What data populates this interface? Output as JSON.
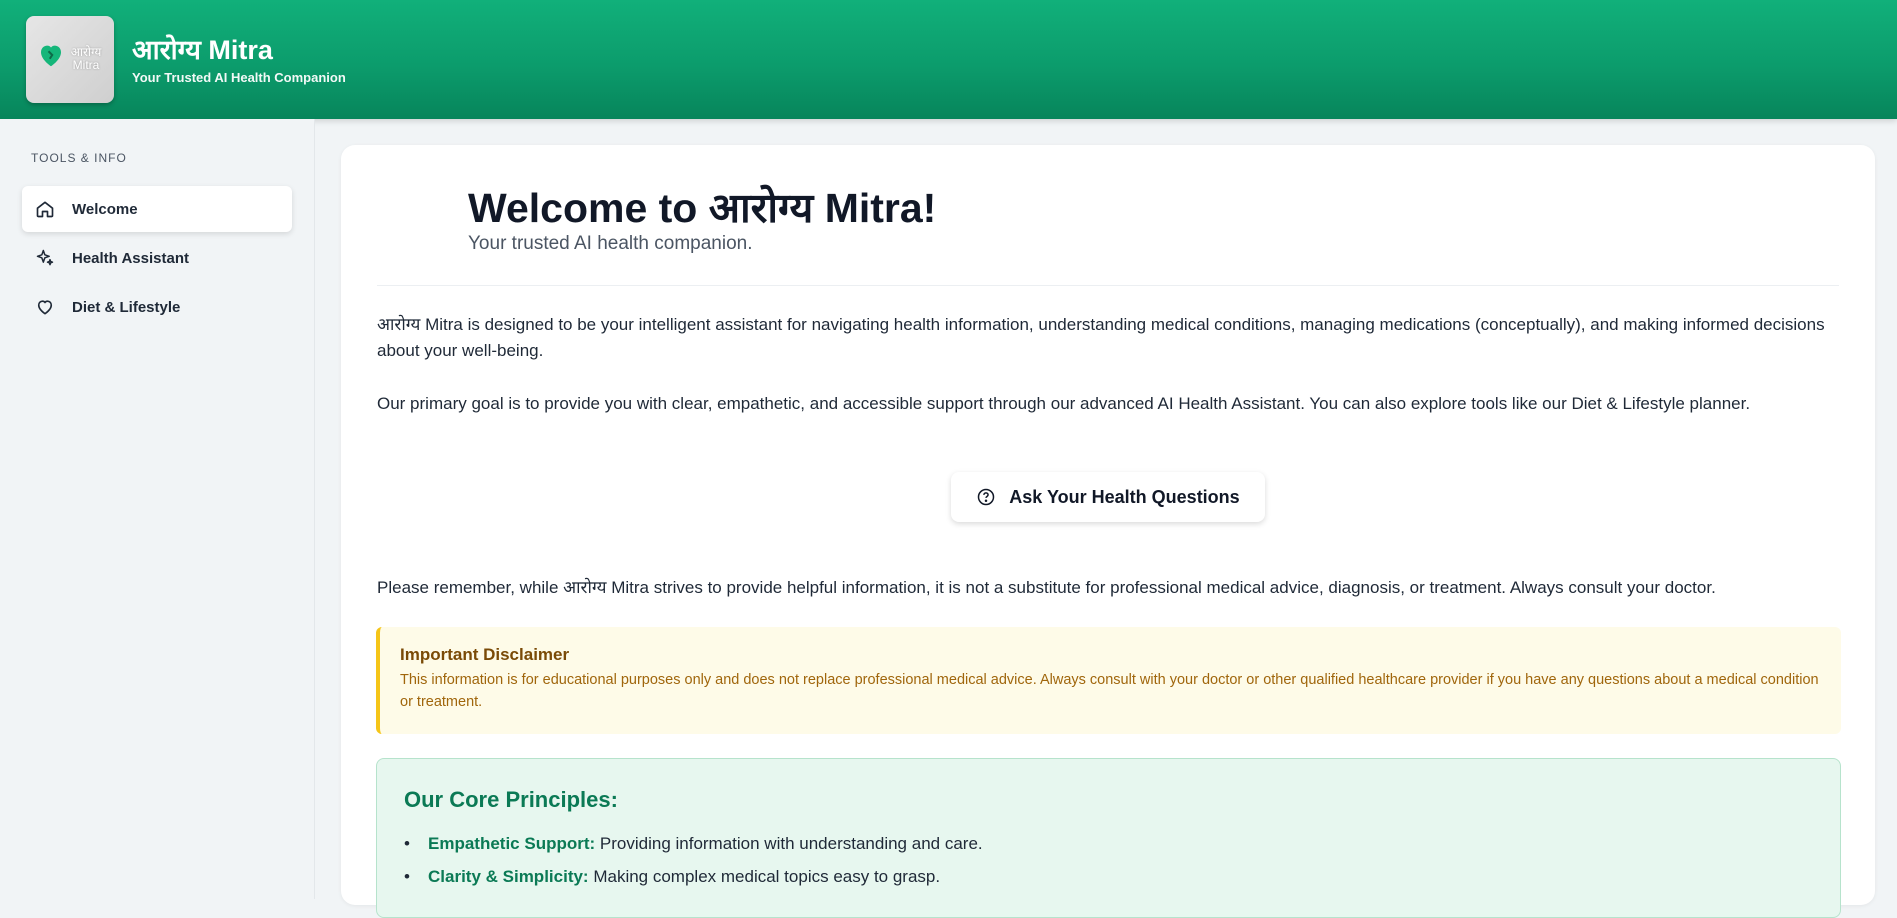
{
  "header": {
    "logo_text": "आरोग्य Mitra",
    "title": "आरोग्य Mitra",
    "subtitle": "Your Trusted AI Health Companion"
  },
  "sidebar": {
    "heading": "TOOLS & INFO",
    "items": [
      {
        "label": "Welcome",
        "icon": "home-icon",
        "active": true
      },
      {
        "label": "Health Assistant",
        "icon": "sparkle-icon",
        "active": false
      },
      {
        "label": "Diet & Lifestyle",
        "icon": "heart-icon",
        "active": false
      }
    ]
  },
  "main": {
    "title": "Welcome to आरोग्य Mitra!",
    "subtitle": "Your trusted AI health companion.",
    "paragraph1": "आरोग्य Mitra is designed to be your intelligent assistant for navigating health information, understanding medical conditions, managing medications (conceptually), and making informed decisions about your well-being.",
    "paragraph2": "Our primary goal is to provide you with clear, empathetic, and accessible support through our advanced AI Health Assistant. You can also explore tools like our Diet & Lifestyle planner.",
    "cta_label": "Ask Your Health Questions",
    "paragraph3": "Please remember, while आरोग्य Mitra strives to provide helpful information, it is not a substitute for professional medical advice, diagnosis, or treatment. Always consult your doctor.",
    "disclaimer": {
      "title": "Important Disclaimer",
      "text": "This information is for educational purposes only and does not replace professional medical advice. Always consult with your doctor or other qualified healthcare provider if you have any questions about a medical condition or treatment."
    },
    "principles": {
      "title": "Our Core Principles:",
      "items": [
        {
          "label": "Empathetic Support:",
          "text": " Providing information with understanding and care."
        },
        {
          "label": "Clarity & Simplicity:",
          "text": " Making complex medical topics easy to grasp."
        }
      ]
    }
  },
  "colors": {
    "brand_green": "#0c9c6c",
    "accent_text": "#0b7a55",
    "warning_border": "#f5c518"
  }
}
